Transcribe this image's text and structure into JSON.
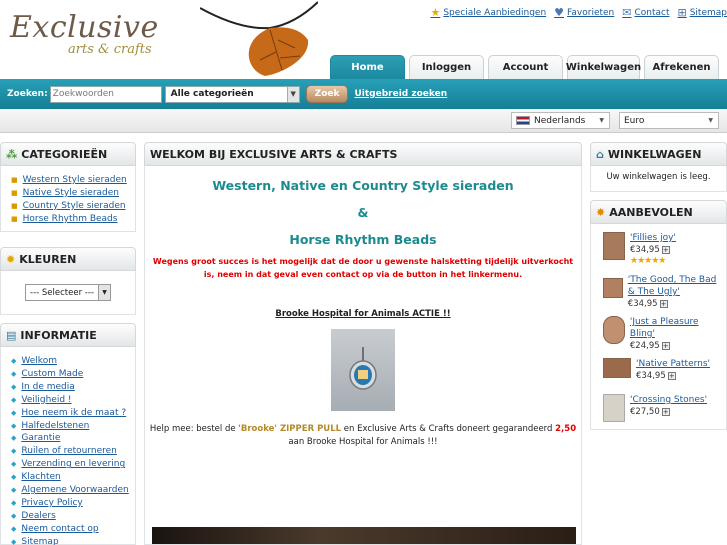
{
  "header": {
    "logo_main": "Exclusive",
    "logo_sub": "arts & crafts",
    "top_links": [
      {
        "icon": "star-icon",
        "label": "Speciale Aanbiedingen"
      },
      {
        "icon": "heart-icon",
        "label": "Favorieten"
      },
      {
        "icon": "mail-icon",
        "label": "Contact"
      },
      {
        "icon": "sitemap-icon",
        "label": "Sitemap"
      }
    ],
    "tabs": [
      "Home",
      "Inloggen",
      "Account",
      "Winkelwagen",
      "Afrekenen"
    ],
    "active_tab": "Home"
  },
  "search": {
    "label": "Zoeken:",
    "placeholder": "Zoekwoorden",
    "category": "Alle categorieën",
    "button": "Zoek",
    "advanced": "Uitgebreid zoeken"
  },
  "locale": {
    "language": "Nederlands",
    "currency": "Euro"
  },
  "categories": {
    "title": "CATEGORIEËN",
    "items": [
      "Western Style sieraden",
      "Native Style sieraden",
      "Country Style sieraden",
      "Horse Rhythm Beads"
    ]
  },
  "colors": {
    "title": "KLEUREN",
    "select": "--- Selecteer ---"
  },
  "info": {
    "title": "INFORMATIE",
    "items": [
      "Welkom",
      "Custom Made",
      "In de media",
      "Veiligheid !",
      "Hoe neem ik de maat ?",
      "Halfedelstenen",
      "Garantie",
      "Ruilen of retourneren",
      "Verzending en levering",
      "Klachten",
      "Algemene Voorwaarden",
      "Privacy Policy",
      "Dealers",
      "Neem contact op",
      "Sitemap"
    ]
  },
  "main": {
    "title": "WELKOM BIJ EXCLUSIVE ARTS & CRAFTS",
    "heading1": "Western, Native en Country Style sieraden",
    "amp": "&",
    "heading2": "Horse Rhythm Beads",
    "notice": "Wegens groot succes is het mogelijk dat de door u gewenste halsketting tijdelijk uitverkocht is, neem in dat geval even contact op via de button in het linkermenu.",
    "promo_title": "Brooke Hospital for Animals ACTIE !! ",
    "help_pre": "Help mee: bestel de ",
    "help_product": "'Brooke' ZIPPER PULL",
    "help_mid": " en Exclusive Arts & Crafts doneert gegarandeerd ",
    "help_amount": "2,50",
    "help_post": "aan Brooke Hospital for Animals !!!"
  },
  "cart": {
    "title": "WINKELWAGEN",
    "empty": "Uw winkelwagen is leeg."
  },
  "recommended": {
    "title": "AANBEVOLEN",
    "products": [
      {
        "name": "'Fillies joy'",
        "price": "€34,95",
        "stars": "★★★★★"
      },
      {
        "name": "'The Good, The Bad & The Ugly'",
        "price": "€34,95",
        "stars": ""
      },
      {
        "name": "'Just a Pleasure Bling'",
        "price": "€24,95",
        "stars": ""
      },
      {
        "name": "'Native Patterns'",
        "price": "€34,95",
        "stars": ""
      },
      {
        "name": "'Crossing Stones'",
        "price": "€27,50",
        "stars": ""
      }
    ]
  }
}
